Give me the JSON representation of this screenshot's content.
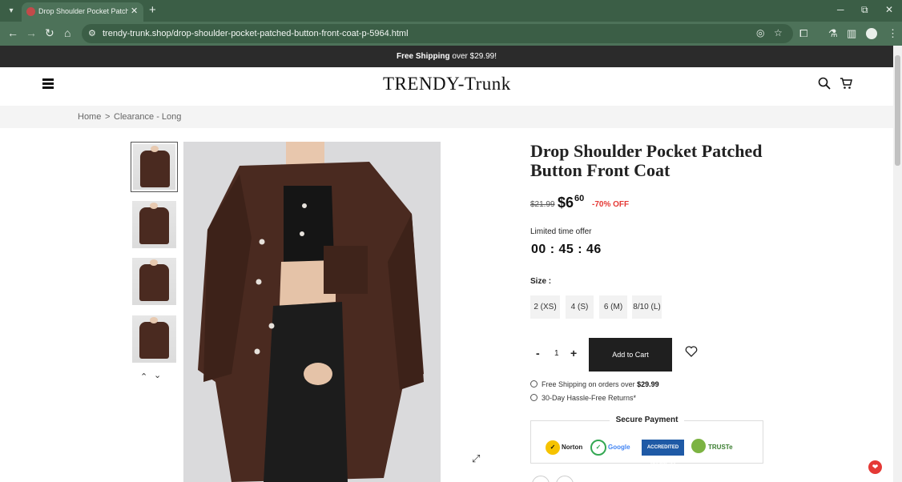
{
  "browser": {
    "tab_title": "Drop Shoulder Pocket Patched",
    "url": "trendy-trunk.shop/drop-shoulder-pocket-patched-button-front-coat-p-5964.html",
    "icons": [
      "tab-search-icon",
      "close-icon",
      "new-tab-icon",
      "minimize-icon",
      "restore-icon",
      "window-close-icon",
      "back-icon",
      "forward-icon",
      "reload-icon",
      "home-icon",
      "site-info-icon",
      "eye-off-icon",
      "star-icon",
      "extensions-icon",
      "chrome-labs-icon",
      "sidebar-icon",
      "profile-icon",
      "more-icon"
    ]
  },
  "announcement": {
    "bold": "Free Shipping",
    "rest": " over $29.99!"
  },
  "header": {
    "logo": "TRENDY-Trunk"
  },
  "breadcrumb": {
    "home": "Home",
    "sep": ">",
    "category": "Clearance - Long"
  },
  "product": {
    "title": "Drop Shoulder Pocket Patched Button Front Coat",
    "price_old": "$21.99",
    "price_dollars": "$6",
    "price_cents": "60",
    "discount": "-70% OFF",
    "offer_label": "Limited time offer",
    "timer": "00 : 45 : 46",
    "size_label": "Size :",
    "sizes": [
      "2 (XS)",
      "4 (S)",
      "6 (M)",
      "8/10 (L)"
    ],
    "qty_minus": "-",
    "quantity": "1",
    "qty_plus": "+",
    "add_to_cart": "Add to Cart",
    "perk1_text": "Free Shipping on orders over ",
    "perk1_bold": "$29.99",
    "perk2_text": "30-Day Hassle-Free Returns*",
    "secure_payment": "Secure Payment",
    "badges": {
      "norton": "Norton",
      "google": "Google",
      "bbb": "ACCREDITED BUSINESS",
      "truste": "TRUSTe"
    }
  },
  "colors": {
    "tabbar": "#3b5e46",
    "toolbar": "#4d7259",
    "announce_bg": "#2b2b2b",
    "discount": "#e53935",
    "coat": "#4a2a20"
  }
}
